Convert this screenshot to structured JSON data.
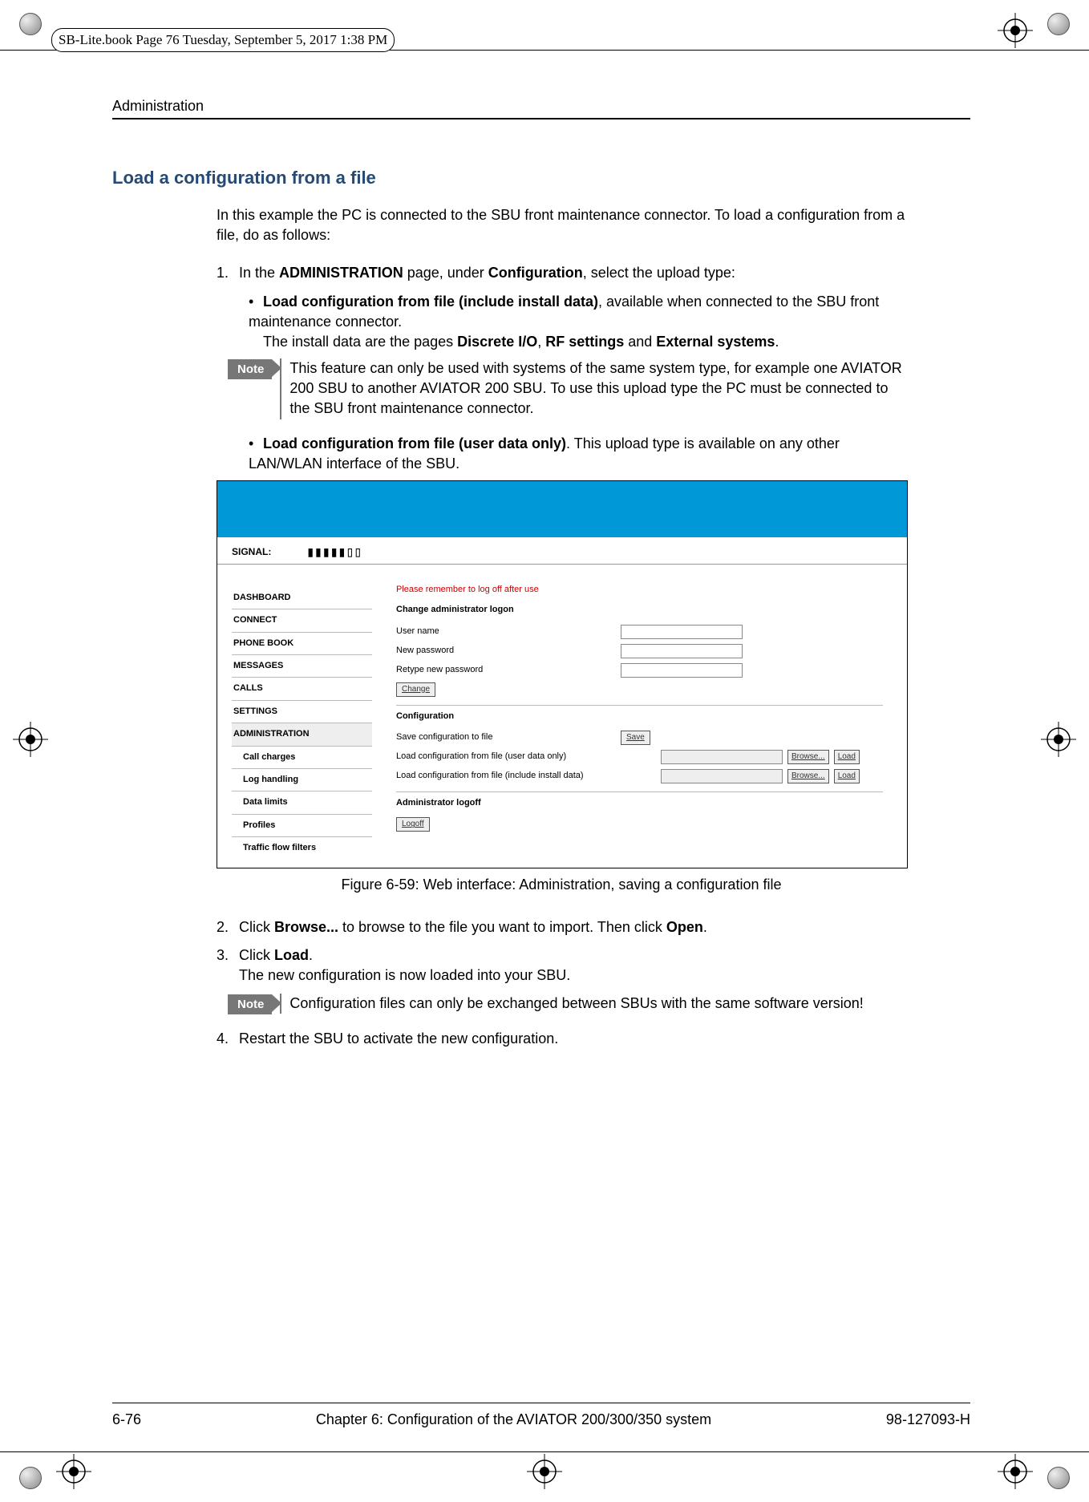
{
  "print_header": "SB-Lite.book  Page 76  Tuesday, September 5, 2017  1:38 PM",
  "running_head": "Administration",
  "section_title": "Load a configuration from a file",
  "intro": "In this example the PC is connected to the SBU front maintenance connector. To load a configuration from a file, do as follows:",
  "step1_lead_a": "1.",
  "step1_lead_b_1": "In the ",
  "step1_lead_b_2": "ADMINISTRATION",
  "step1_lead_b_3": " page, under ",
  "step1_lead_b_4": "Configuration",
  "step1_lead_b_5": ", select the upload type:",
  "step1b1_a": "Load configuration from file (include install data)",
  "step1b1_b": ", available when connected to the SBU front maintenance connector.",
  "step1b1_c_1": "The install data are the pages ",
  "step1b1_c_2": "Discrete I/O",
  "step1b1_c_3": ", ",
  "step1b1_c_4": "RF settings",
  "step1b1_c_5": " and ",
  "step1b1_c_6": "External systems",
  "step1b1_c_7": ".",
  "note1_label": "Note",
  "note1_text": "This feature can only be used with systems of the same system type, for example one AVIATOR 200 SBU to another AVIATOR 200 SBU. To use this upload type the PC must be connected to the SBU front maintenance connector.",
  "step1b2_a": "Load configuration from file (user data only)",
  "step1b2_b": ". This upload type is available on any other LAN/WLAN interface of the SBU.",
  "ss": {
    "signal_label": "SIGNAL:",
    "signal_bars": "▮▮▮▮▮▯▯",
    "nav": [
      "DASHBOARD",
      "CONNECT",
      "PHONE BOOK",
      "MESSAGES",
      "CALLS",
      "SETTINGS",
      "ADMINISTRATION"
    ],
    "nav_sub": [
      "Call charges",
      "Log handling",
      "Data limits",
      "Profiles",
      "Traffic flow filters"
    ],
    "warn": "Please remember to log off after use",
    "h1": "Change administrator logon",
    "row_user": "User name",
    "row_newpw": "New password",
    "row_rtpw": "Retype new password",
    "btn_change": "Change",
    "h2": "Configuration",
    "row_save": "Save configuration to file",
    "btn_save": "Save",
    "row_userdata": "Load configuration from file (user data only)",
    "row_install": "Load configuration from file (include install data)",
    "btn_browse": "Browse...",
    "btn_load": "Load",
    "h3": "Administrator logoff",
    "btn_logoff": "Logoff"
  },
  "caption": "Figure 6-59: Web interface: Administration, saving a configuration file",
  "step2_num": "2.",
  "step2_a": "Click ",
  "step2_b": "Browse...",
  "step2_c": " to browse to the file you want to import. Then click ",
  "step2_d": "Open",
  "step2_e": ".",
  "step3_num": "3.",
  "step3_a": "Click ",
  "step3_b": "Load",
  "step3_c": ".",
  "step3_line2": "The new configuration is now loaded into your SBU.",
  "note2_label": "Note",
  "note2_text": "Configuration files can only be exchanged between SBUs with the same software version!",
  "step4_num": "4.",
  "step4_text": "Restart the SBU to activate the new configuration.",
  "footer_left": "6-76",
  "footer_center": "Chapter 6:  Configuration of the AVIATOR 200/300/350 system",
  "footer_right": "98-127093-H"
}
